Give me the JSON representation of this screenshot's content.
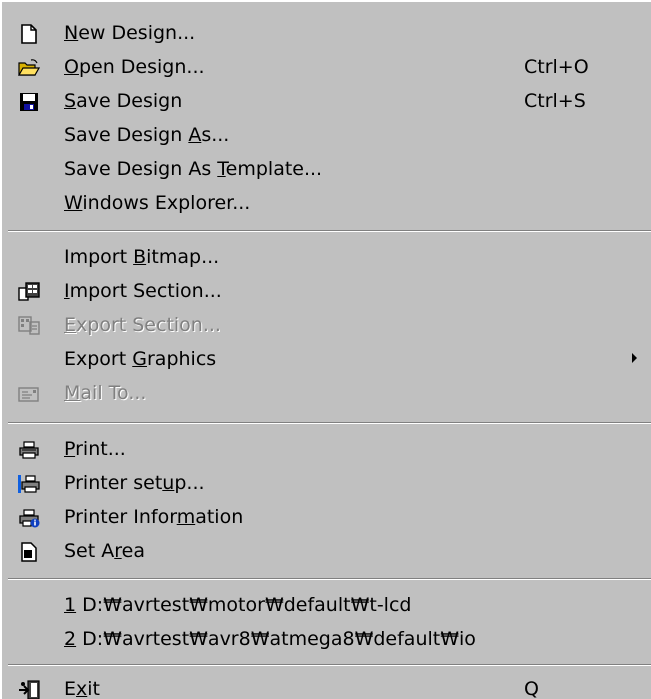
{
  "menu": {
    "items": [
      {
        "id": "new-design",
        "label_parts": [
          "",
          "N",
          "ew Design..."
        ],
        "shortcut": "",
        "icon": "new-document-icon",
        "enabled": true
      },
      {
        "id": "open-design",
        "label_parts": [
          "",
          "O",
          "pen Design..."
        ],
        "shortcut": "Ctrl+O",
        "icon": "open-folder-icon",
        "enabled": true
      },
      {
        "id": "save-design",
        "label_parts": [
          "",
          "S",
          "ave Design"
        ],
        "shortcut": "Ctrl+S",
        "icon": "floppy-disk-icon",
        "enabled": true
      },
      {
        "id": "save-design-as",
        "label_parts": [
          "Save Design ",
          "A",
          "s..."
        ],
        "shortcut": "",
        "icon": "",
        "enabled": true
      },
      {
        "id": "save-design-as-template",
        "label_parts": [
          "Save Design As ",
          "T",
          "emplate..."
        ],
        "shortcut": "",
        "icon": "",
        "enabled": true
      },
      {
        "id": "windows-explorer",
        "label_parts": [
          "",
          "W",
          "indows Explorer..."
        ],
        "shortcut": "",
        "icon": "",
        "enabled": true
      },
      {
        "id": "import-bitmap",
        "label_parts": [
          "Import ",
          "B",
          "itmap..."
        ],
        "shortcut": "",
        "icon": "",
        "enabled": true
      },
      {
        "id": "import-section",
        "label_parts": [
          "",
          "I",
          "mport Section..."
        ],
        "shortcut": "",
        "icon": "import-section-icon",
        "enabled": true
      },
      {
        "id": "export-section",
        "label_parts": [
          "",
          "E",
          "xport Section..."
        ],
        "shortcut": "",
        "icon": "export-section-icon",
        "enabled": false
      },
      {
        "id": "export-graphics",
        "label_parts": [
          "Export ",
          "G",
          "raphics"
        ],
        "shortcut": "",
        "icon": "",
        "enabled": true,
        "submenu": true
      },
      {
        "id": "mail-to",
        "label_parts": [
          "",
          "M",
          "ail To..."
        ],
        "shortcut": "",
        "icon": "mail-icon",
        "enabled": false
      },
      {
        "id": "print",
        "label_parts": [
          "",
          "P",
          "rint..."
        ],
        "shortcut": "",
        "icon": "printer-icon",
        "enabled": true
      },
      {
        "id": "printer-setup",
        "label_parts": [
          "Printer set",
          "u",
          "p..."
        ],
        "shortcut": "",
        "icon": "printer-setup-icon",
        "enabled": true
      },
      {
        "id": "printer-information",
        "label_parts": [
          "Printer Infor",
          "m",
          "ation"
        ],
        "shortcut": "",
        "icon": "printer-info-icon",
        "enabled": true
      },
      {
        "id": "set-area",
        "label_parts": [
          "Set A",
          "r",
          "ea"
        ],
        "shortcut": "",
        "icon": "set-area-icon",
        "enabled": true
      },
      {
        "id": "recent-file-1",
        "label_parts": [
          "",
          "1",
          " D:₩avrtest₩motor₩default₩t-lcd"
        ],
        "shortcut": "",
        "icon": "",
        "enabled": true
      },
      {
        "id": "recent-file-2",
        "label_parts": [
          "",
          "2",
          " D:₩avrtest₩avr8₩atmega8₩default₩io"
        ],
        "shortcut": "",
        "icon": "",
        "enabled": true
      },
      {
        "id": "exit",
        "label_parts": [
          "E",
          "x",
          "it"
        ],
        "shortcut": "Q",
        "icon": "exit-icon",
        "enabled": true
      }
    ]
  }
}
